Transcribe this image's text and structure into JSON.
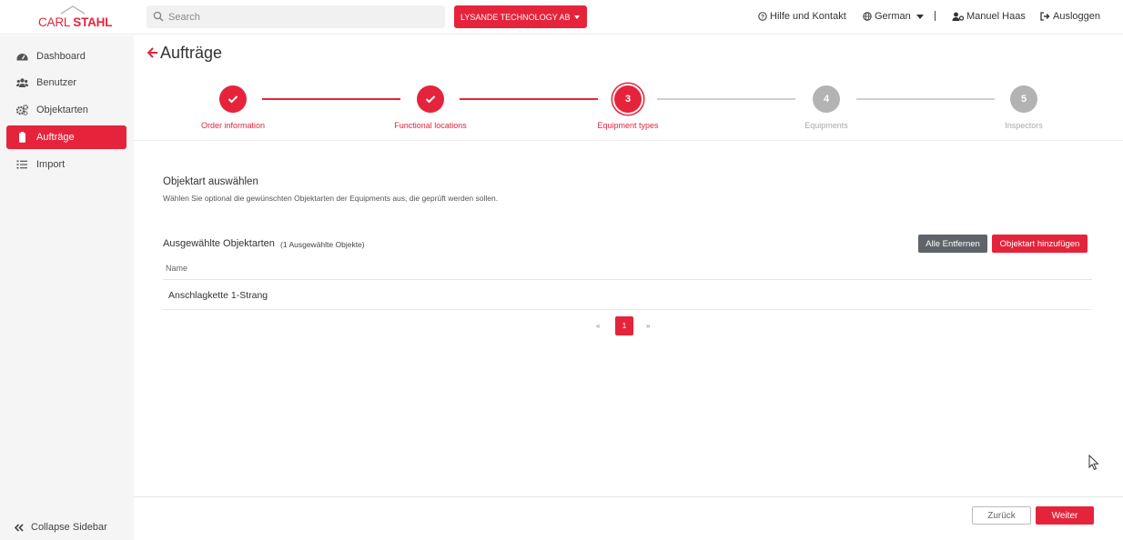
{
  "brand": {
    "logo_text_light": "CARL ",
    "logo_text_bold": "STAHL",
    "accent_color": "#e5243b"
  },
  "header": {
    "search_placeholder": "Search",
    "company": "LYSANDE TECHNOLOGY AB",
    "help": "Hilfe und Kontakt",
    "language": "German",
    "user": "Manuel Haas",
    "logout": "Ausloggen"
  },
  "sidebar": {
    "items": [
      {
        "label": "Dashboard",
        "icon": "dashboard-icon"
      },
      {
        "label": "Benutzer",
        "icon": "users-icon"
      },
      {
        "label": "Objektarten",
        "icon": "gears-icon"
      },
      {
        "label": "Aufträge",
        "icon": "clipboard-icon",
        "active": true
      },
      {
        "label": "Import",
        "icon": "list-icon"
      }
    ],
    "collapse": "Collapse Sidebar"
  },
  "page": {
    "title": "Aufträge"
  },
  "stepper": {
    "current_step": 3,
    "steps": [
      {
        "label": "Order information",
        "state": "done"
      },
      {
        "label": "Functional locations",
        "state": "done"
      },
      {
        "number": "3",
        "label": "Equipment types",
        "state": "current"
      },
      {
        "number": "4",
        "label": "Equipments",
        "state": "todo"
      },
      {
        "number": "5",
        "label": "Inspectors",
        "state": "todo"
      }
    ]
  },
  "section": {
    "title": "Objektart auswählen",
    "subtitle": "Wählen Sie optional die gewünschten Objektarten der Equipments aus, die geprüft werden sollen."
  },
  "selected": {
    "title": "Ausgewählte Objektarten",
    "count": "(1 Ausgewählte Objekte)",
    "remove_all": "Alle Entfernen",
    "add": "Objektart hinzufügen"
  },
  "table": {
    "columns": [
      "Name"
    ],
    "rows": [
      [
        "Anschlagkette 1-Strang"
      ]
    ]
  },
  "pagination": {
    "prev": "«",
    "current": "1",
    "next": "»"
  },
  "footer": {
    "back": "Zurück",
    "next": "Weiter"
  }
}
